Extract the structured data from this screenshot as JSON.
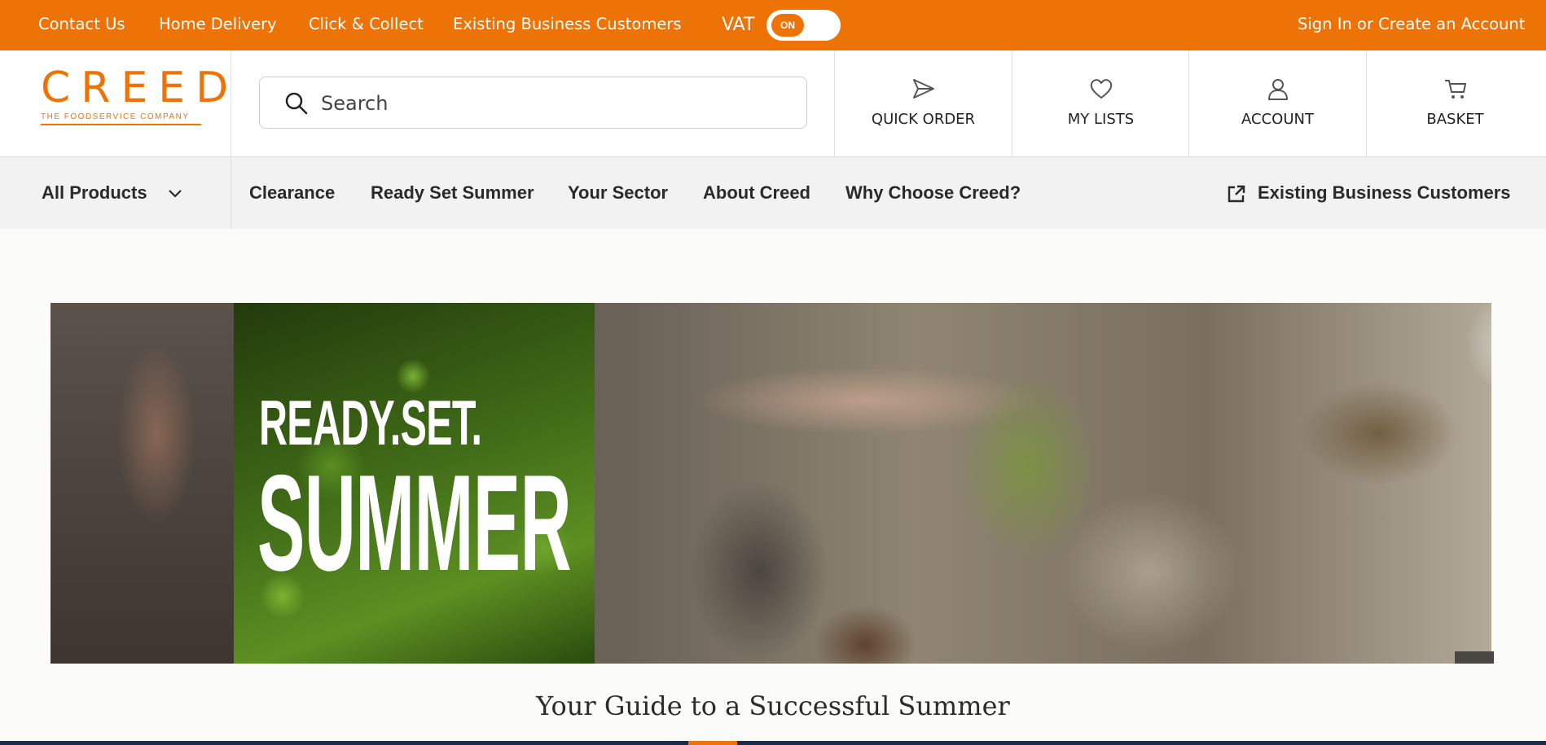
{
  "topbar": {
    "links": [
      "Contact Us",
      "Home Delivery",
      "Click & Collect",
      "Existing Business Customers"
    ],
    "vat_label": "VAT",
    "vat_toggle": "ON",
    "signin": "Sign In or Create an Account",
    "color": "#ee7307"
  },
  "header": {
    "logo_word": "CREED",
    "logo_tagline": "THE FOODSERVICE COMPANY",
    "search_placeholder": "Search",
    "buttons": {
      "quick_order": "QUICK ORDER",
      "my_lists": "MY LISTS",
      "account": "ACCOUNT",
      "basket": "BASKET"
    }
  },
  "nav": {
    "all_products": "All Products",
    "items": [
      "Clearance",
      "Ready Set Summer",
      "Your Sector",
      "About Creed",
      "Why Choose Creed?"
    ],
    "existing": "Existing Business Customers"
  },
  "hero": {
    "line1": "READY.SET.",
    "line2": "SUMMER"
  },
  "guide_title": "Your Guide to a Successful Summer"
}
